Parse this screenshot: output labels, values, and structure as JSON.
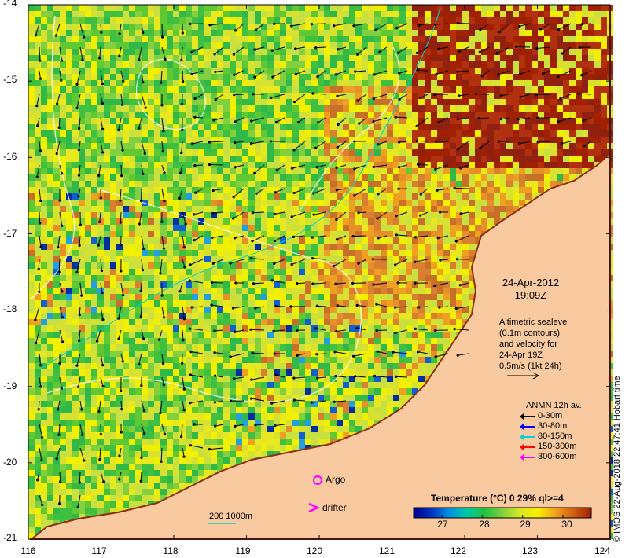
{
  "map": {
    "lon_ticks": [
      "116",
      "117",
      "118",
      "119",
      "120",
      "121",
      "122",
      "123",
      "124"
    ],
    "lat_ticks": [
      "-14",
      "-15",
      "-16",
      "-17",
      "-18",
      "-19",
      "-20",
      "-21"
    ],
    "lon_range": [
      116,
      124
    ],
    "lat_range": [
      -21,
      -14
    ],
    "colors": {
      "land": "#f9c99f",
      "coast": "#8b2e13",
      "contour": "#ffffff",
      "frame": "#000000"
    }
  },
  "annotation": {
    "date": "24-Apr-2012",
    "time": "19:09Z",
    "altimetry_lines": [
      "Altimetric sealevel",
      "(0.1m contours)",
      "and velocity for",
      "24-Apr 19Z",
      "0.5m/s (1kt 24h)"
    ]
  },
  "legend": {
    "title": "ANMN 12h av.",
    "items": [
      {
        "label": "0-30m",
        "color": "#000000"
      },
      {
        "label": "30-80m",
        "color": "#0000ff"
      },
      {
        "label": "80-150m",
        "color": "#00d4d4"
      },
      {
        "label": "150-300m",
        "color": "#ff0000"
      },
      {
        "label": "300-600m",
        "color": "#ff00ff"
      }
    ]
  },
  "markers": {
    "argo_label": "Argo",
    "drifter_label": "drifter",
    "argo_color": "#ff00ff",
    "drifter_color": "#ff00ff"
  },
  "scale": {
    "label": "200  1000m",
    "color": "#00d4d4"
  },
  "colorbar": {
    "title": "Temperature (°C) 0 29% ql>=4",
    "ticks": [
      "27",
      "28",
      "29",
      "30"
    ],
    "range": [
      26.3,
      30.7
    ],
    "stops": [
      "#00008b",
      "#0030c0",
      "#0090e0",
      "#00c8a0",
      "#20c040",
      "#80d040",
      "#d8e820",
      "#f8f000",
      "#f0a020",
      "#d06010",
      "#a02000"
    ]
  },
  "credit": "© IMOS 22-Aug-2018 22:47:41 Hobart time"
}
